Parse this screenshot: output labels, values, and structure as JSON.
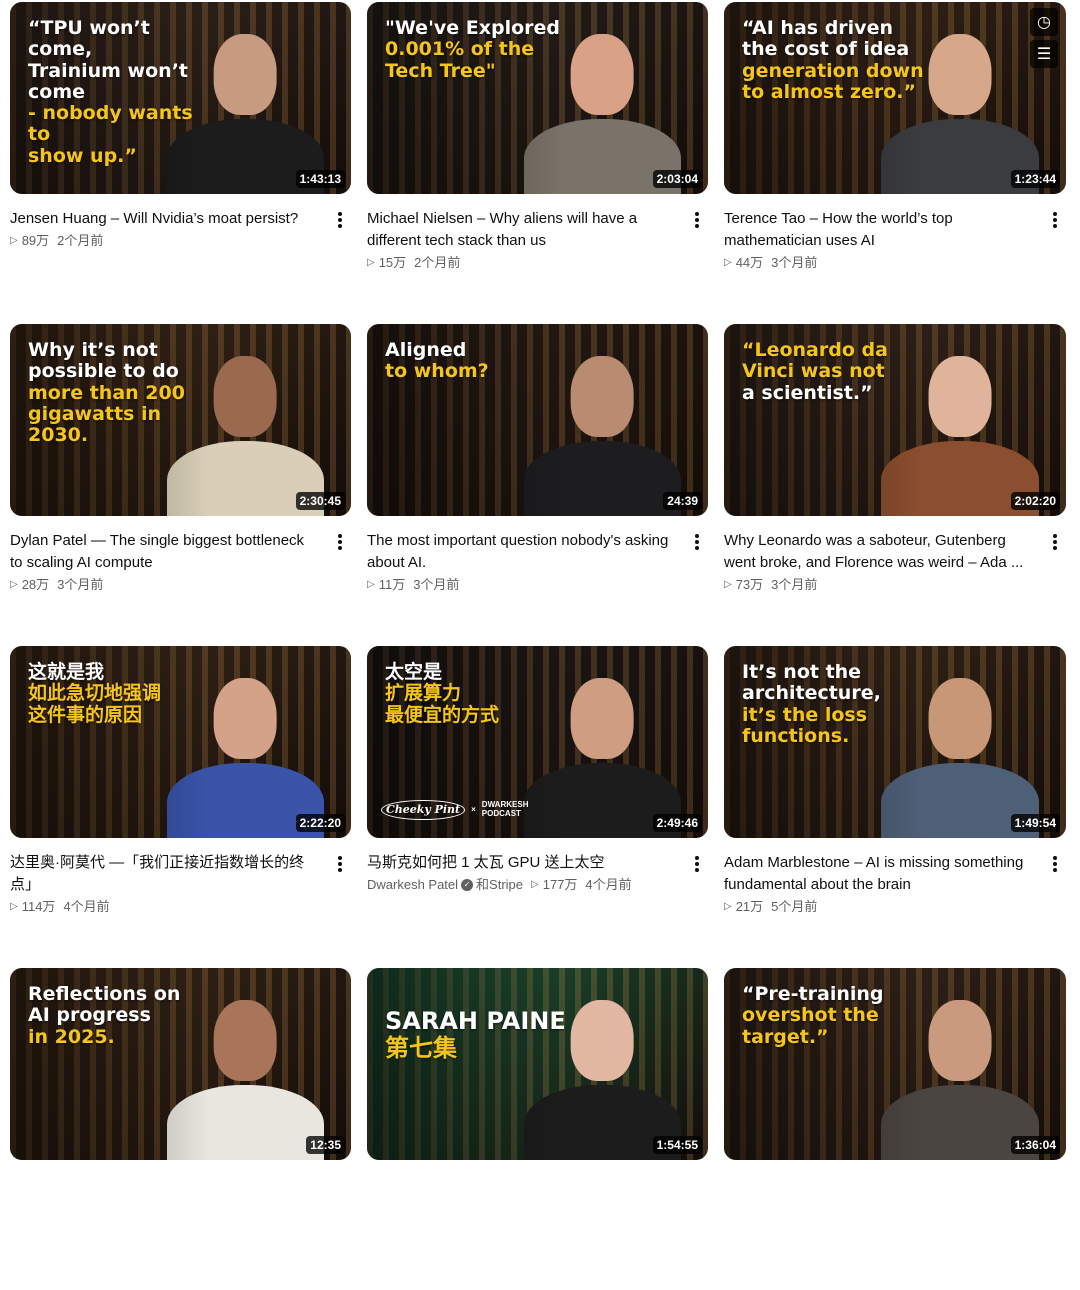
{
  "hover_icons": [
    "clock-icon",
    "queue-icon"
  ],
  "videos": [
    {
      "quote_lines": [
        "“TPU won’t come,",
        "Trainium won’t come",
        "- nobody wants to",
        "show up.”"
      ],
      "highlight_lines": [
        2,
        3
      ],
      "duration": "1:43:13",
      "title": "Jensen Huang – Will Nvidia’s moat persist?",
      "views": "89万",
      "age": "2个月前",
      "bg": "#3a2a22",
      "skin": "#c79b7f",
      "shirt": "#1c1c1c"
    },
    {
      "quote_lines": [
        "\"We've Explored",
        "0.001% of the",
        "Tech Tree\""
      ],
      "highlight_lines": [
        1,
        2
      ],
      "duration": "2:03:04",
      "title": "Michael Nielsen – Why aliens will have a different tech stack than us",
      "views": "15万",
      "age": "2个月前",
      "bg": "#2b2420",
      "skin": "#d9a287",
      "shirt": "#7a7369"
    },
    {
      "quote_lines": [
        "“AI has driven",
        "the cost of idea",
        "generation down",
        "to almost zero.”"
      ],
      "highlight_lines": [
        2,
        3
      ],
      "duration": "1:23:44",
      "title": "Terence Tao – How the world’s top mathematician uses AI",
      "views": "44万",
      "age": "3个月前",
      "bg": "#3d2a1c",
      "skin": "#d6a789",
      "shirt": "#3a3c40"
    },
    {
      "quote_lines": [
        "Why it’s not",
        "possible to do",
        "more than 200",
        "gigawatts in",
        "2030."
      ],
      "highlight_lines": [
        2,
        3,
        4
      ],
      "duration": "2:30:45",
      "title": "Dylan Patel — The single biggest bottleneck to scaling AI compute",
      "views": "28万",
      "age": "3个月前",
      "bg": "#402b1b",
      "skin": "#9b6a4e",
      "shirt": "#d9cfb8"
    },
    {
      "quote_lines": [
        "Aligned",
        "to whom?"
      ],
      "highlight_lines": [
        1
      ],
      "duration": "24:39",
      "title": "The most important question nobody's asking about AI.",
      "views": "11万",
      "age": "3个月前",
      "bg": "#2a1e18",
      "skin": "#b98b71",
      "shirt": "#1d1d1f"
    },
    {
      "quote_lines": [
        "“Leonardo da",
        "Vinci was not",
        "a scientist.”"
      ],
      "highlight_lines": [
        0,
        1
      ],
      "duration": "2:02:20",
      "title": "Why Leonardo was a saboteur, Gutenberg went broke, and Florence was weird – Ada ...",
      "views": "73万",
      "age": "3个月前",
      "bg": "#3b2a1f",
      "skin": "#e0b49a",
      "shirt": "#8b4e2e"
    },
    {
      "quote_lines": [
        "这就是我",
        "如此急切地强调",
        "这件事的原因"
      ],
      "highlight_lines": [
        1,
        2
      ],
      "duration": "2:22:20",
      "title": "达里奥·阿莫代 —「我们正接近指数增长的终点」",
      "views": "114万",
      "age": "4个月前",
      "bg": "#3e2a1b",
      "skin": "#d3a288",
      "shirt": "#3954a8"
    },
    {
      "quote_lines": [
        "太空是",
        "扩展算力",
        "最便宜的方式"
      ],
      "highlight_lines": [
        1,
        2
      ],
      "duration": "2:49:46",
      "title": "马斯克如何把 1 太瓦 GPU 送上太空",
      "channel": "Dwarkesh Patel",
      "channel_suffix": "和Stripe",
      "views": "177万",
      "age": "4个月前",
      "badge": {
        "logo": "Cheeky Pint",
        "sep": "×",
        "name_top": "DWARKESH",
        "name_bottom": "PODCAST"
      },
      "bg": "#1f1a18",
      "skin": "#cf9d82",
      "shirt": "#1c1c1c"
    },
    {
      "quote_lines": [
        "It’s not the",
        "architecture,",
        "it’s the loss",
        "functions."
      ],
      "highlight_lines": [
        2,
        3
      ],
      "duration": "1:49:54",
      "title": "Adam Marblestone – AI is missing something fundamental about the brain",
      "views": "21万",
      "age": "5个月前",
      "bg": "#3c2a1c",
      "skin": "#c89778",
      "shirt": "#4e6078"
    },
    {
      "quote_lines": [
        "Reflections on",
        "AI progress",
        "in 2025."
      ],
      "highlight_lines": [
        2
      ],
      "duration": "12:35",
      "title": "",
      "views": "",
      "age": "",
      "bg": "#3e2a1b",
      "skin": "#a87559",
      "shirt": "#e9e6df"
    },
    {
      "quote_lines": [
        "SARAH PAINE",
        "第七集"
      ],
      "highlight_lines": [
        1
      ],
      "duration": "1:54:55",
      "title": "",
      "views": "",
      "age": "",
      "bg": "#1f5a3c",
      "skin": "#e1b7a2",
      "shirt": "#1c1c1c"
    },
    {
      "quote_lines": [
        "“Pre-training",
        "overshot the",
        "target.”"
      ],
      "highlight_lines": [
        1,
        2
      ],
      "duration": "1:36:04",
      "title": "",
      "views": "",
      "age": "",
      "bg": "#3b2a1e",
      "skin": "#c99a7e",
      "shirt": "#4a4540"
    }
  ]
}
